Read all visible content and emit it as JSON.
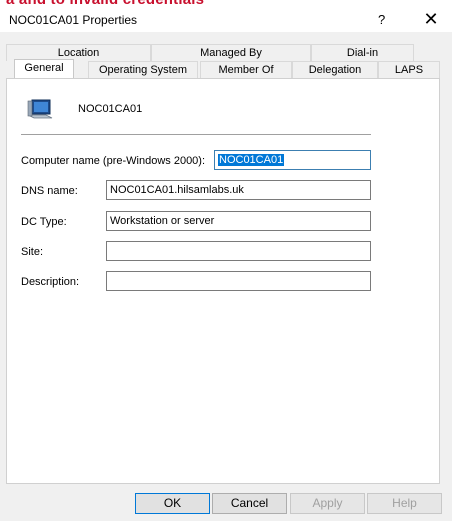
{
  "banner": {
    "text": "a and to invalid credentials"
  },
  "window": {
    "title": "NOC01CA01 Properties",
    "help_glyph": "?",
    "close_glyph": "✕"
  },
  "tabs": {
    "back_row": [
      "Location",
      "Managed By",
      "Dial-in"
    ],
    "front_row": [
      "General",
      "Operating System",
      "Member Of",
      "Delegation",
      "LAPS"
    ],
    "active": "General"
  },
  "general": {
    "computer_display_name": "NOC01CA01",
    "computer_icon": "computer-icon",
    "fields": {
      "prewin2000_label": "Computer name (pre-Windows 2000):",
      "prewin2000_value": "NOC01CA01",
      "dns_label": "DNS name:",
      "dns_value": "NOC01CA01.hilsamlabs.uk",
      "dctype_label": "DC Type:",
      "dctype_value": "Workstation or server",
      "site_label": "Site:",
      "site_value": "",
      "description_label": "Description:",
      "description_value": ""
    }
  },
  "buttons": {
    "ok": "OK",
    "cancel": "Cancel",
    "apply": "Apply",
    "help": "Help"
  },
  "colors": {
    "selection": "#0078d7",
    "banner_text": "#c8102e"
  }
}
